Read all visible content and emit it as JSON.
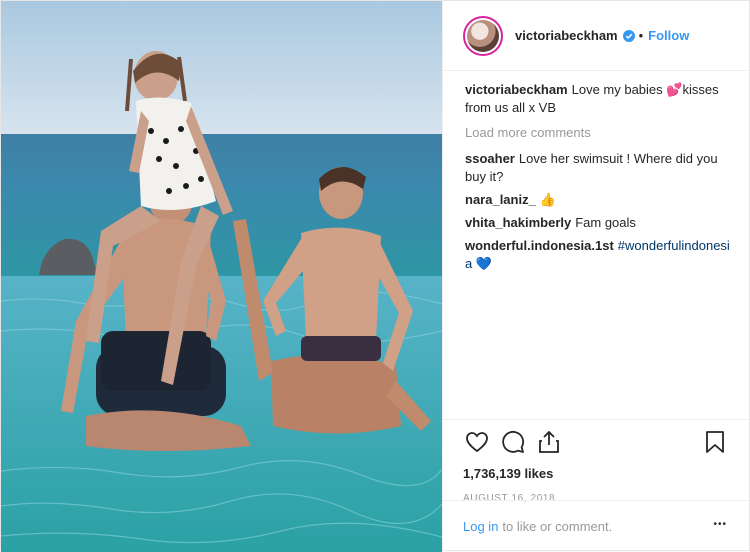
{
  "post": {
    "photo_alt": "",
    "owner": "victoriabeckham",
    "verified": true,
    "follow_separator": "•",
    "follow_label": "Follow",
    "caption": {
      "username": "victoriabeckham",
      "text_before": "Love my babies ",
      "emoji": "💕",
      "text_after": "kisses from us all x VB"
    },
    "load_more_label": "Load more comments",
    "comments": [
      {
        "username": "ssoaher",
        "text": "Love her swimsuit ! Where did you buy it?"
      },
      {
        "username": "nara_laniz_",
        "text": "👍"
      },
      {
        "username": "vhita_hakimberly",
        "text": "Fam goals"
      },
      {
        "username": "wonderful.indonesia.1st",
        "text": "#wonderfulindonesia",
        "emoji": "💙"
      }
    ],
    "likes": "1,736,139 likes",
    "date": "AUGUST 16, 2018",
    "login_label": "Log in",
    "login_suffix": "to like or comment.",
    "more_label": "•••"
  },
  "icons": [
    "heart-icon",
    "comment-icon",
    "share-icon",
    "bookmark-icon",
    "more-options-icon",
    "verified-badge-icon"
  ],
  "colors": {
    "link": "#3897f0",
    "text": "#262626",
    "muted": "#999999",
    "hashtag": "#003569",
    "border": "#efefef"
  }
}
